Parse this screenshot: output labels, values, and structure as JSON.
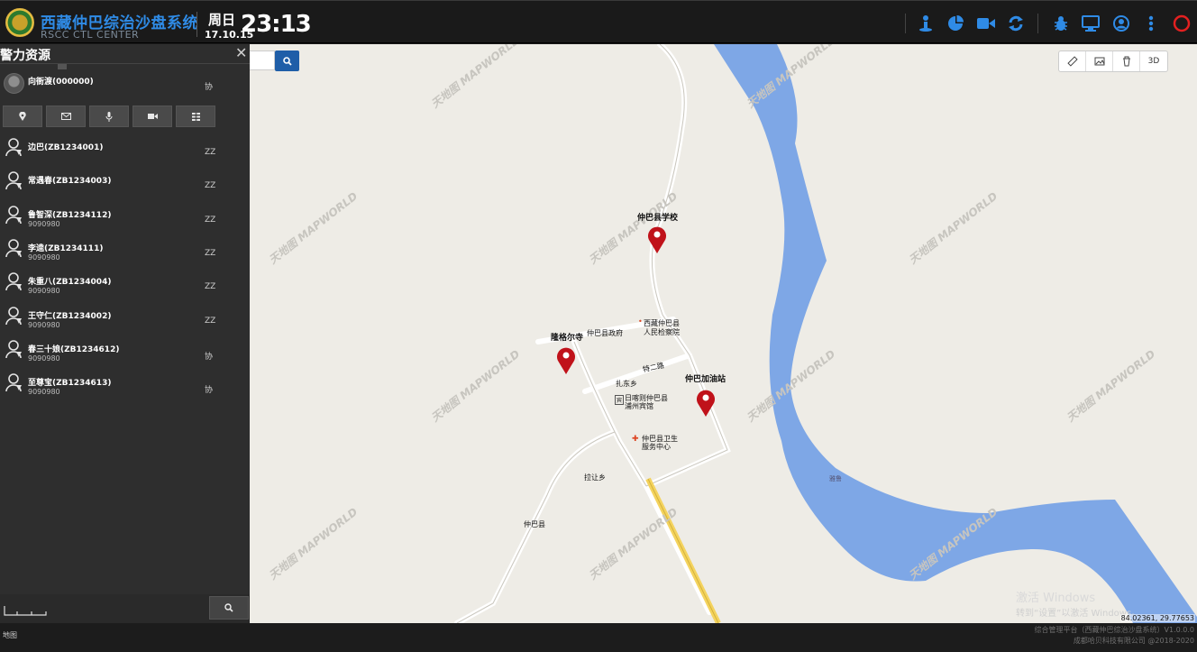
{
  "header": {
    "title": "西藏仲巴综治沙盘系统",
    "subtitle": "RSCC CTL CENTER",
    "weekday": "周日",
    "date": "17.10.15",
    "time": "23:13",
    "accent": "#2f8be6",
    "toolbar_icons": [
      "locate-person-icon",
      "pie-chart-icon",
      "video-camera-icon",
      "refresh-icon",
      "bug-icon",
      "monitor-icon",
      "user-icon",
      "more-vertical-icon",
      "power-icon"
    ]
  },
  "sidebar": {
    "title": "警力资源",
    "lead": {
      "name": "向衙渡(000000)",
      "status": "协"
    },
    "action_icons": [
      "location-pin-icon",
      "envelope-icon",
      "microphone-icon",
      "video-icon",
      "grid-icon"
    ],
    "people": [
      {
        "name": "边巴(ZB1234001)",
        "sub": "",
        "status": "ZZ"
      },
      {
        "name": "常遇春(ZB1234003)",
        "sub": "",
        "status": "ZZ"
      },
      {
        "name": "鲁智深(ZB1234112)",
        "sub": "9090980",
        "status": "ZZ"
      },
      {
        "name": "李逵(ZB1234111)",
        "sub": "9090980",
        "status": "ZZ"
      },
      {
        "name": "朱重八(ZB1234004)",
        "sub": "9090980",
        "status": "ZZ"
      },
      {
        "name": "王守仁(ZB1234002)",
        "sub": "9090980",
        "status": "ZZ"
      },
      {
        "name": "春三十娘(ZB1234612)",
        "sub": "9090980",
        "status": "协"
      },
      {
        "name": "至尊宝(ZB1234613)",
        "sub": "9090980",
        "status": "协"
      }
    ]
  },
  "map": {
    "tools": [
      "ruler-icon",
      "image-icon",
      "trash-icon",
      "3D"
    ],
    "labels": {
      "school": "仲巴县学校",
      "temple": "隆格尔寺",
      "gas": "仲巴加油站",
      "gov": "仲巴县政府",
      "court1": "西藏仲巴县",
      "court2": "人民检察院",
      "road1": "扎东乡",
      "road2": "特二路",
      "hotel1": "日喀则仲巴县",
      "hotel2": "浦州宾馆",
      "health1": "仲巴县卫生",
      "health2": "服务中心",
      "lara": "拉让乡",
      "zhongba": "仲巴县",
      "river": "雅鲁",
      "hotel_icon": "宾"
    },
    "watermark": "天地图 MAPWORLD",
    "activate1": "激活 Windows",
    "activate2": "转到“设置”以激活 Windows。",
    "coords": "84.02361, 29.77653",
    "river_color": "#7ea7e6"
  },
  "footer": {
    "left": "地图",
    "right1": "综合管理平台（西藏仲巴综治沙盘系统）V1.0.0.0",
    "right2": "成都哈贝科技有限公司 @2018-2020"
  }
}
